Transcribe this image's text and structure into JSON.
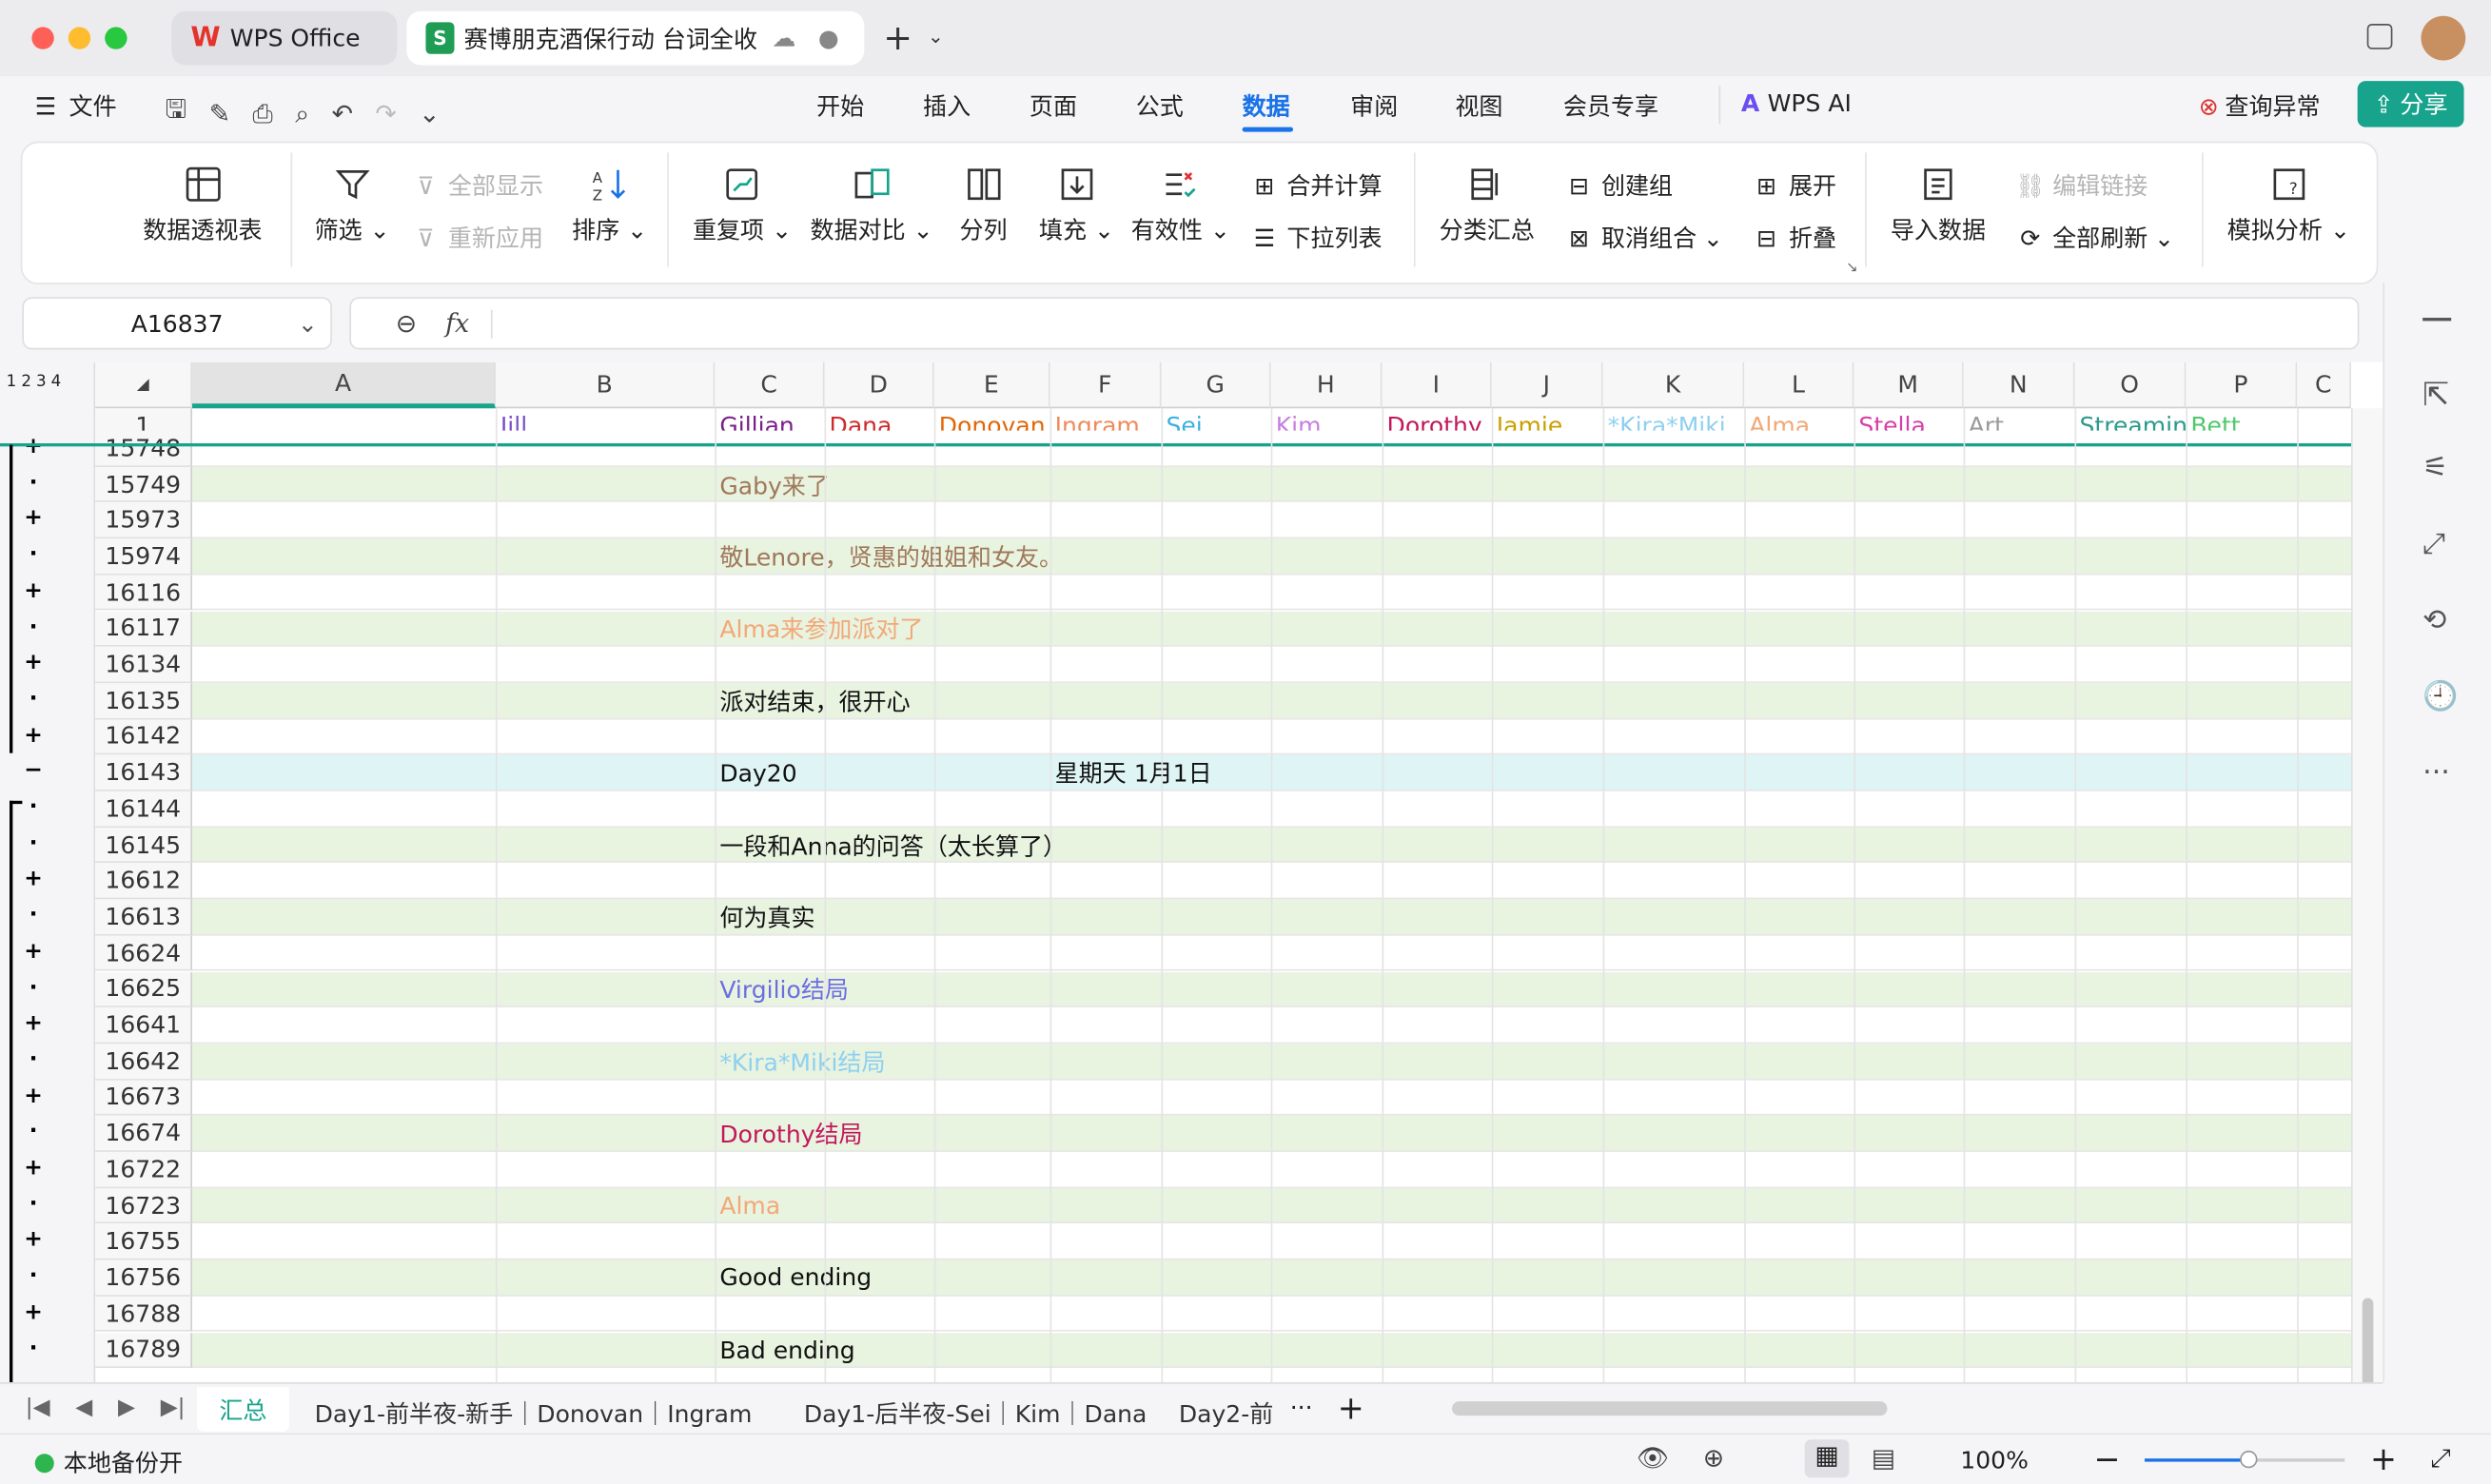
{
  "window": {
    "app_tab": "WPS Office",
    "doc_tab": "赛博朋克酒保行动 台词全收"
  },
  "menu": {
    "file": "文件",
    "tabs": [
      "开始",
      "插入",
      "页面",
      "公式",
      "数据",
      "审阅",
      "视图",
      "会员专享"
    ],
    "active_tab": "数据",
    "ai": "WPS AI",
    "check": "查询异常",
    "share": "分享"
  },
  "ribbon": {
    "pivot": "数据透视表",
    "filter": "筛选",
    "show_all": "全部显示",
    "reapply": "重新应用",
    "sort": "排序",
    "dup": "重复项",
    "compare": "数据对比",
    "split": "分列",
    "fill": "填充",
    "valid": "有效性",
    "merge_calc": "合并计算",
    "dropdown": "下拉列表",
    "subtotal": "分类汇总",
    "group": "创建组",
    "ungroup": "取消组合",
    "expand": "展开",
    "collapse": "折叠",
    "import": "导入数据",
    "edit_links": "编辑链接",
    "refresh_all": "全部刷新",
    "whatif": "模拟分析"
  },
  "formula": {
    "cell_ref": "A16837",
    "fx": "fx",
    "value": ""
  },
  "outline_levels": [
    "1",
    "2",
    "3",
    "4"
  ],
  "columns": [
    "A",
    "B",
    "C",
    "D",
    "E",
    "F",
    "G",
    "H",
    "I",
    "J",
    "K",
    "L",
    "M",
    "N",
    "O",
    "P",
    "C"
  ],
  "header_row": {
    "num": "1",
    "names": [
      {
        "text": "Jill",
        "color": "#7b4fc9"
      },
      {
        "text": "Gillian",
        "color": "#7a1f8a"
      },
      {
        "text": "Dana",
        "color": "#d02a2a"
      },
      {
        "text": "Donovan",
        "color": "#e0680a"
      },
      {
        "text": "Ingram",
        "color": "#f08a5a"
      },
      {
        "text": "Sei",
        "color": "#3bb0e0"
      },
      {
        "text": "Kim",
        "color": "#c77ee0"
      },
      {
        "text": "Dorothy",
        "color": "#c2185b"
      },
      {
        "text": "Jamie",
        "color": "#c9a000"
      },
      {
        "text": "*Kira*Miki",
        "color": "#8fd0ef"
      },
      {
        "text": "Alma",
        "color": "#f2a878"
      },
      {
        "text": "Stella",
        "color": "#d63fa8"
      },
      {
        "text": "Art",
        "color": "#9a9a9a"
      },
      {
        "text": "Streaming-chan",
        "color": "#2a9a8a"
      },
      {
        "text": "Bett",
        "color": "#4fc86a"
      }
    ]
  },
  "rows": [
    {
      "num": "15748",
      "sym": "+",
      "text": "",
      "color": ""
    },
    {
      "num": "15749",
      "sym": "·",
      "text": "Gaby来了",
      "color": "#a0785a"
    },
    {
      "num": "15973",
      "sym": "+",
      "text": "",
      "color": ""
    },
    {
      "num": "15974",
      "sym": "·",
      "text": "敬Lenore，贤惠的姐姐和女友。",
      "color": "#a0785a"
    },
    {
      "num": "16116",
      "sym": "+",
      "text": "",
      "color": ""
    },
    {
      "num": "16117",
      "sym": "·",
      "text": "Alma来参加派对了",
      "color": "#f2a878"
    },
    {
      "num": "16134",
      "sym": "+",
      "text": "",
      "color": ""
    },
    {
      "num": "16135",
      "sym": "·",
      "text": "派对结束，很开心",
      "color": "#111"
    },
    {
      "num": "16142",
      "sym": "+",
      "text": "",
      "color": ""
    },
    {
      "num": "16143",
      "sym": "−",
      "text": "Day20",
      "color": "#111",
      "extra": "星期天 1月1日"
    },
    {
      "num": "16144",
      "sym": "·",
      "text": "",
      "color": ""
    },
    {
      "num": "16145",
      "sym": "·",
      "text": "一段和Anna的问答（太长算了）",
      "color": "#111"
    },
    {
      "num": "16612",
      "sym": "+",
      "text": "",
      "color": ""
    },
    {
      "num": "16613",
      "sym": "·",
      "text": "何为真实",
      "color": "#111"
    },
    {
      "num": "16624",
      "sym": "+",
      "text": "",
      "color": ""
    },
    {
      "num": "16625",
      "sym": "·",
      "text": "Virgilio结局",
      "color": "#6b6ee0"
    },
    {
      "num": "16641",
      "sym": "+",
      "text": "",
      "color": ""
    },
    {
      "num": "16642",
      "sym": "·",
      "text": "*Kira*Miki结局",
      "color": "#8fd0ef"
    },
    {
      "num": "16673",
      "sym": "+",
      "text": "",
      "color": ""
    },
    {
      "num": "16674",
      "sym": "·",
      "text": "Dorothy结局",
      "color": "#c2185b"
    },
    {
      "num": "16722",
      "sym": "+",
      "text": "",
      "color": ""
    },
    {
      "num": "16723",
      "sym": "·",
      "text": "Alma",
      "color": "#f2a878"
    },
    {
      "num": "16755",
      "sym": "+",
      "text": "",
      "color": ""
    },
    {
      "num": "16756",
      "sym": "·",
      "text": "Good ending",
      "color": "#111"
    },
    {
      "num": "16788",
      "sym": "+",
      "text": "",
      "color": ""
    },
    {
      "num": "16789",
      "sym": "·",
      "text": "Bad ending",
      "color": "#111"
    }
  ],
  "sheet_tabs": [
    "汇总",
    "Day1-前半夜-新手｜Donovan｜Ingram",
    "Day1-后半夜-Sei｜Kim｜Dana",
    "Day2-前"
  ],
  "status": {
    "backup": "本地备份开",
    "zoom": "100%"
  }
}
